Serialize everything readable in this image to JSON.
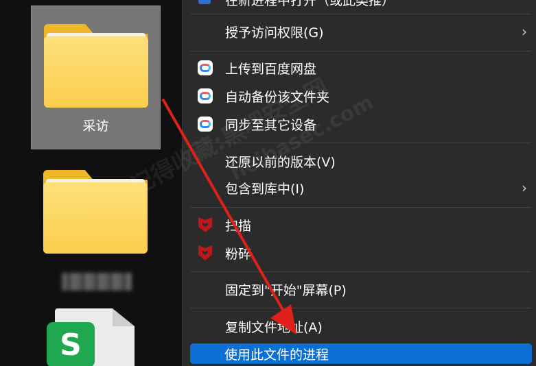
{
  "desktop": {
    "items": [
      {
        "label": "采访",
        "icon": "folder-icon",
        "selected": true
      },
      {
        "label": "",
        "icon": "folder-icon",
        "selected": false
      },
      {
        "label": "",
        "icon": "spreadsheet-file-icon",
        "badge": "S"
      }
    ]
  },
  "menu": {
    "top_partial": "在新进程中打开（或此类推）",
    "items": [
      {
        "label": "授予访问权限(G)",
        "icon": "",
        "submenu": true
      },
      {
        "label": "上传到百度网盘",
        "icon": "baidu-netdisk-icon",
        "submenu": false
      },
      {
        "label": "自动备份该文件夹",
        "icon": "baidu-netdisk-icon",
        "submenu": false
      },
      {
        "label": "同步至其它设备",
        "icon": "baidu-netdisk-icon",
        "submenu": false
      },
      {
        "label": "还原以前的版本(V)",
        "icon": "",
        "submenu": false
      },
      {
        "label": "包含到库中(I)",
        "icon": "",
        "submenu": true
      },
      {
        "label": "扫描",
        "icon": "mcafee-icon",
        "submenu": false
      },
      {
        "label": "粉碎",
        "icon": "mcafee-icon",
        "submenu": false
      },
      {
        "label": "固定到\"开始\"屏幕(P)",
        "icon": "",
        "submenu": false
      },
      {
        "label": "复制文件地址(A)",
        "icon": "",
        "submenu": false
      },
      {
        "label": "使用此文件的进程",
        "icon": "",
        "submenu": false,
        "highlighted": true
      }
    ],
    "chevron": "›"
  },
  "watermark": {
    "text_1": "记得收藏:黑吧安全网",
    "text_2": "heibasec.com"
  },
  "colors": {
    "menu_bg": "#2b2b2b",
    "highlight": "#0b6fd3",
    "arrow": "#e0201a",
    "folder": "#fccd4d"
  }
}
